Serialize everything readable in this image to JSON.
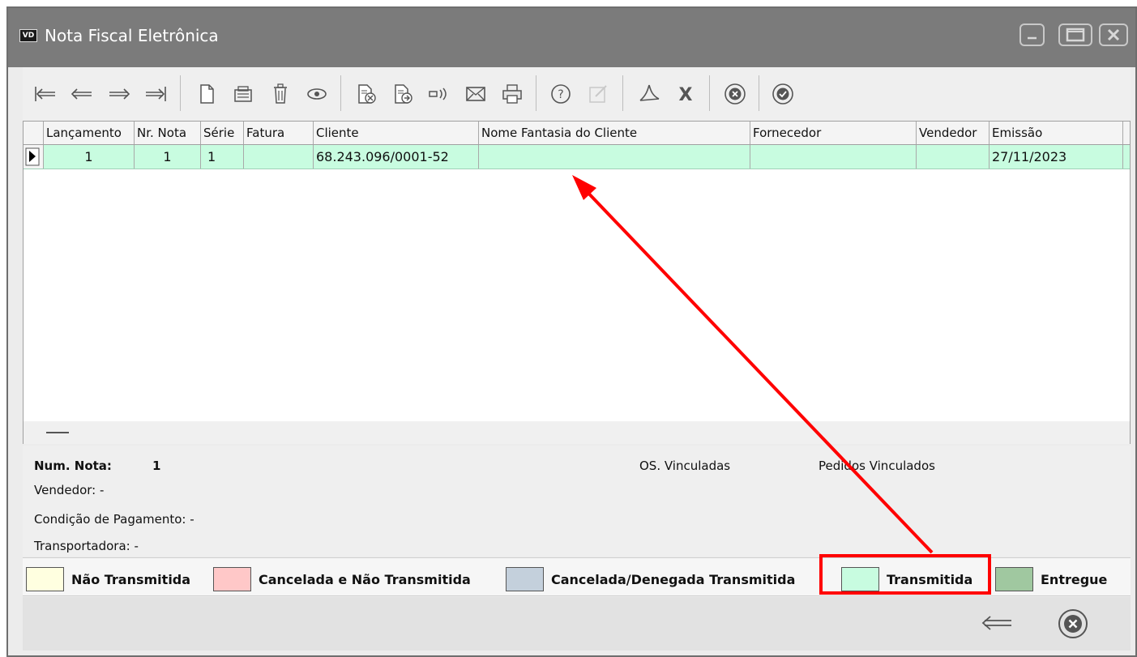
{
  "window": {
    "app_icon_text": "VD",
    "title": "Nota Fiscal Eletrônica"
  },
  "toolbar": {
    "icons": [
      "first-record-icon",
      "previous-record-icon",
      "next-record-icon",
      "last-record-icon",
      "new-document-icon",
      "edit-icon",
      "delete-icon",
      "view-icon",
      "cancel-document-icon",
      "transmit-document-icon",
      "broadcast-icon",
      "email-icon",
      "print-icon",
      "help-icon",
      "disabled-edit-icon",
      "pdf-icon",
      "excel-icon",
      "close-circle-icon",
      "confirm-check-icon"
    ]
  },
  "grid": {
    "columns": [
      "Lançamento",
      "Nr. Nota",
      "Série",
      "Fatura",
      "Cliente",
      "Nome Fantasia do Cliente",
      "Fornecedor",
      "Vendedor",
      "Emissão"
    ],
    "rows": [
      {
        "lancamento": "1",
        "nr_nota": "1",
        "serie": "1",
        "fatura": "",
        "cliente": "68.243.096/0001-52",
        "nome_fantasia": "",
        "fornecedor": "",
        "vendedor": "",
        "emissao": "27/11/2023",
        "row_color": "#c8fce0"
      }
    ]
  },
  "details": {
    "num_nota_label": "Num. Nota:",
    "num_nota_value": "1",
    "vendedor": "Vendedor: -",
    "condicao": "Condição de Pagamento: -",
    "transportadora": "Transportadora: -",
    "os_vinculadas": "OS. Vinculadas",
    "pedidos_vinculados": "Pedidos Vinculados"
  },
  "legend": [
    {
      "label": "Não Transmitida",
      "color": "#ffffe0"
    },
    {
      "label": "Cancelada e Não Transmitida",
      "color": "#ffc8c8"
    },
    {
      "label": "Cancelada/Denegada Transmitida",
      "color": "#c4d0dc"
    },
    {
      "label": "Transmitida",
      "color": "#c8fce0"
    },
    {
      "label": "Entregue",
      "color": "#a0c8a0"
    }
  ],
  "annotation_color": "#ff0000"
}
